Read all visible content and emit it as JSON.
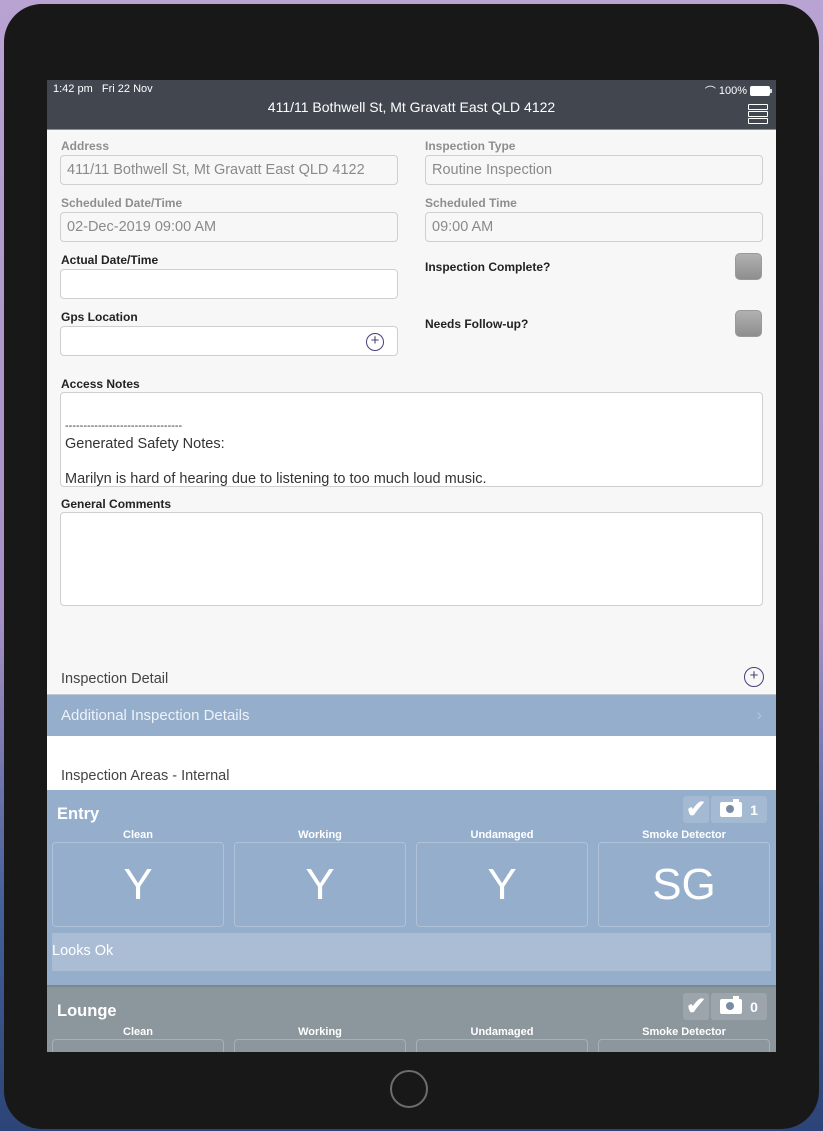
{
  "status_bar": {
    "time": "1:42 pm",
    "date": "Fri 22 Nov",
    "battery": "100%"
  },
  "header": {
    "title": "411/11 Bothwell St, Mt Gravatt East QLD 4122"
  },
  "form": {
    "address": {
      "label": "Address",
      "value": "411/11 Bothwell St, Mt Gravatt East QLD 4122"
    },
    "inspection_type": {
      "label": "Inspection Type",
      "value": "Routine Inspection"
    },
    "scheduled_datetime": {
      "label": "Scheduled Date/Time",
      "value": "02-Dec-2019 09:00 AM"
    },
    "scheduled_time": {
      "label": "Scheduled Time",
      "value": "09:00 AM"
    },
    "actual_datetime": {
      "label": "Actual Date/Time",
      "value": ""
    },
    "inspection_complete": {
      "label": "Inspection Complete?",
      "checked": false
    },
    "gps_location": {
      "label": "Gps Location",
      "value": ""
    },
    "needs_followup": {
      "label": "Needs Follow-up?",
      "checked": false
    },
    "access_notes": {
      "label": "Access Notes",
      "lines": [
        "--------------------------------",
        "Generated Safety Notes:",
        "Marilyn is hard of hearing due to listening to too much loud music."
      ]
    },
    "general_comments": {
      "label": "General Comments",
      "value": ""
    }
  },
  "inspection_detail": {
    "title": "Inspection Detail",
    "rows": [
      {
        "label": "Additional Inspection Details"
      }
    ]
  },
  "inspection_areas": {
    "title": "Inspection Areas - Internal",
    "columns": [
      "Clean",
      "Working",
      "Undamaged",
      "Smoke Detector"
    ],
    "areas": [
      {
        "name": "Entry",
        "photo_count": "1",
        "values": [
          "Y",
          "Y",
          "Y",
          "SG"
        ],
        "comment": "Looks Ok"
      },
      {
        "name": "Lounge",
        "photo_count": "0",
        "values": [
          "",
          "",
          "",
          ""
        ],
        "comment": ""
      }
    ]
  },
  "colors": {
    "nav_bar": "#41464f",
    "row_blue": "#95aecb",
    "row_grey": "#8b969d",
    "accent": "#4a3f7a"
  }
}
